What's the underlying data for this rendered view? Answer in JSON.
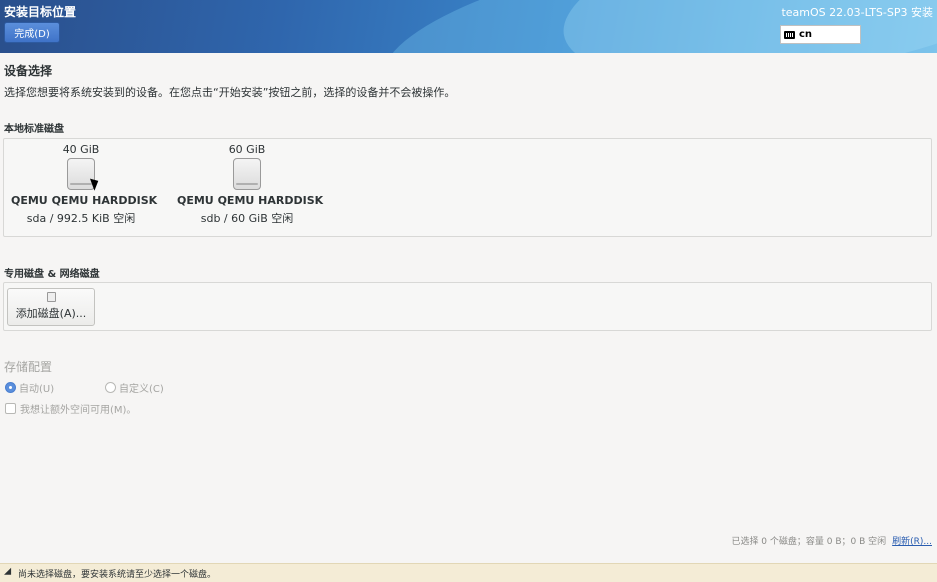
{
  "header": {
    "title": "安装目标位置",
    "done_label": "完成(D)",
    "product_title": "teamOS 22.03-LTS-SP3 安装",
    "keyboard_layout": "cn"
  },
  "device_selection": {
    "title": "设备选择",
    "description": "选择您想要将系统安装到的设备。在您点击“开始安装”按钮之前，选择的设备并不会被操作。"
  },
  "local_disks": {
    "title": "本地标准磁盘",
    "disks": [
      {
        "size": "40 GiB",
        "name": "QEMU QEMU HARDDISK",
        "info": "sda   /   992.5 KiB 空闲"
      },
      {
        "size": "60 GiB",
        "name": "QEMU QEMU HARDDISK",
        "info": "sdb   /   60 GiB 空闲"
      }
    ]
  },
  "specialized_disks": {
    "title": "专用磁盘 & 网络磁盘",
    "add_disk_label": "添加磁盘(A)..."
  },
  "storage_config": {
    "title": "存储配置",
    "options": [
      {
        "label": "自动(U)",
        "checked": true
      },
      {
        "label": "自定义(C)",
        "checked": false
      }
    ],
    "extra_space_label": "我想让额外空间可用(M)。"
  },
  "summary": {
    "text": "已选择 0 个磁盘；容量 0 B；0 B 空闲",
    "refresh_label": "刷新(R)..."
  },
  "warning": {
    "text": "尚未选择磁盘，要安装系统请至少选择一个磁盘。"
  },
  "colors": {
    "accent": "#3f73c8",
    "warning_bg": "#f4ecd6"
  }
}
